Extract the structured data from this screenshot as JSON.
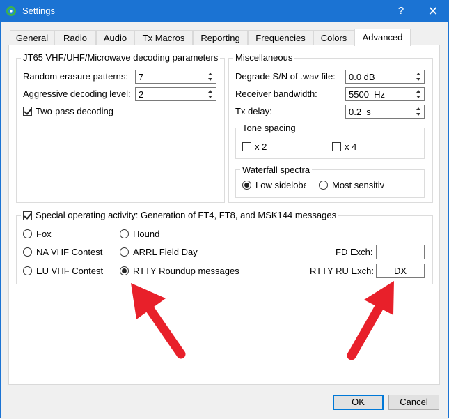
{
  "window": {
    "title": "Settings",
    "help_glyph": "?",
    "close_glyph": "✕"
  },
  "tabs": [
    {
      "label": "General"
    },
    {
      "label": "Radio"
    },
    {
      "label": "Audio"
    },
    {
      "label": "Tx Macros"
    },
    {
      "label": "Reporting"
    },
    {
      "label": "Frequencies"
    },
    {
      "label": "Colors"
    },
    {
      "label": "Advanced",
      "active": true
    }
  ],
  "jt65": {
    "title": "JT65 VHF/UHF/Microwave decoding parameters",
    "random_erasure_label": "Random erasure patterns:",
    "random_erasure_value": "7",
    "aggressive_label": "Aggressive decoding level:",
    "aggressive_value": "2",
    "two_pass_label": "Two-pass decoding",
    "two_pass_checked": true
  },
  "misc": {
    "title": "Miscellaneous",
    "degrade_label": "Degrade S/N of .wav file:",
    "degrade_value": "0.0 dB",
    "bandwidth_label": "Receiver bandwidth:",
    "bandwidth_value": "5500  Hz",
    "txdelay_label": "Tx delay:",
    "txdelay_value": "0.2  s",
    "tone_title": "Tone spacing",
    "x2_label": "x 2",
    "x4_label": "x 4",
    "waterfall_title": "Waterfall spectra",
    "low_sidelobe_label": "Low sidelobes",
    "most_sensitive_label": "Most sensitive"
  },
  "special": {
    "title": "Special operating activity:  Generation of FT4, FT8, and MSK144 messages",
    "checked": true,
    "fox_label": "Fox",
    "hound_label": "Hound",
    "na_vhf_label": "NA VHF Contest",
    "arrl_label": "ARRL Field Day",
    "eu_vhf_label": "EU VHF Contest",
    "rtty_label": "RTTY Roundup messages",
    "selected": "rtty",
    "fd_exch_label": "FD Exch:",
    "fd_exch_value": "",
    "rtty_exch_label": "RTTY RU Exch:",
    "rtty_exch_value": "DX"
  },
  "buttons": {
    "ok": "OK",
    "cancel": "Cancel"
  },
  "colors": {
    "titlebar": "#1b73d3",
    "arrow": "#e8202a",
    "accent": "#0078d7"
  }
}
